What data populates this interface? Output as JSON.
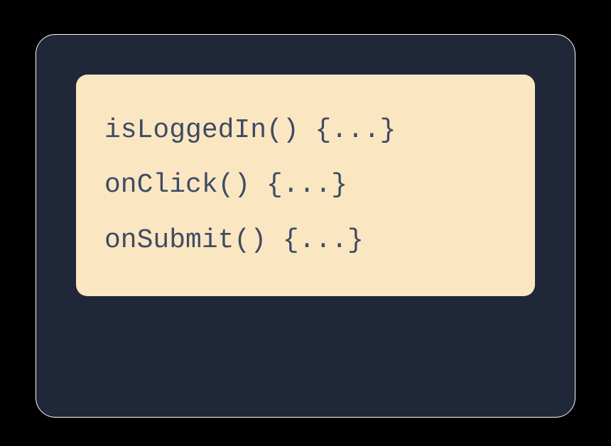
{
  "code_lines": [
    "isLoggedIn() {...}",
    "onClick() {...}",
    "onSubmit() {...}"
  ]
}
